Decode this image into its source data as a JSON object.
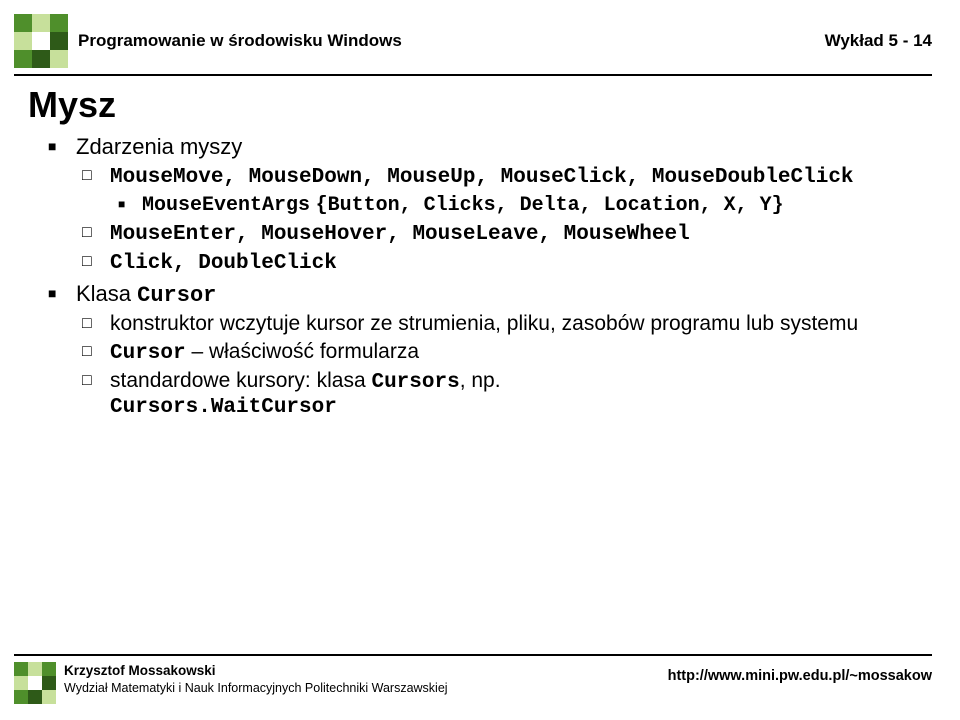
{
  "header": {
    "course": "Programowanie w środowisku Windows",
    "lecture": "Wykład 5 - 14"
  },
  "title": "Mysz",
  "sections": [
    {
      "label": "Zdarzenia myszy",
      "items": [
        {
          "mono_line": "MouseMove, MouseDown, MouseUp, MouseClick, MouseDoubleClick",
          "sub_mono_prefix": "MouseEventArgs",
          "sub_mono_body": "{Button, Clicks, Delta, Location, X, Y}"
        },
        {
          "mono_line": "MouseEnter, MouseHover, MouseLeave, MouseWheel"
        },
        {
          "mono_line": "Click, DoubleClick"
        }
      ]
    },
    {
      "label_prefix": "Klasa ",
      "label_mono": "Cursor",
      "items": [
        {
          "text": "konstruktor wczytuje kursor ze strumienia, pliku, zasobów programu lub systemu"
        },
        {
          "mono_prefix": "Cursor",
          "text_suffix": " – właściwość formularza"
        },
        {
          "text_prefix": "standardowe kursory: klasa ",
          "mono_inline": "Cursors",
          "text_mid": ", np. ",
          "mono_line2": "Cursors.WaitCursor"
        }
      ]
    }
  ],
  "footer": {
    "author": "Krzysztof Mossakowski",
    "affiliation": "Wydział Matematyki i Nauk Informacyjnych Politechniki Warszawskiej",
    "url": "http://www.mini.pw.edu.pl/~mossakow"
  }
}
